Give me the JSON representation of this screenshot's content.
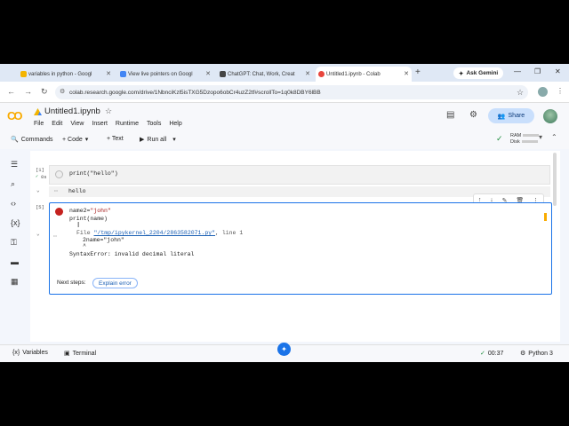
{
  "browser": {
    "tabs": [
      {
        "label": "variables in python - Googl",
        "fav_color": "#f4b400"
      },
      {
        "label": "View live pointers on Googl",
        "fav_color": "#4285f4"
      },
      {
        "label": "ChatGPT: Chat, Work, Creat",
        "fav_color": "#444444"
      },
      {
        "label": "Untitled1.ipynb - Colab",
        "fav_color": "#e8453c"
      }
    ],
    "new_tab": "+",
    "ask_gemini": "Ask Gemini",
    "url": "colab.research.google.com/drive/1NbnciKzl5isTXG5Dzopo6obCr4uzZ2tf#scrollTo=1q0k8DBY6lBB"
  },
  "colab": {
    "logo": "CO",
    "notebook_title": "Untitled1.ipynb",
    "menu": [
      "File",
      "Edit",
      "View",
      "Insert",
      "Runtime",
      "Tools",
      "Help"
    ],
    "share_label": "Share",
    "toolbar": {
      "commands": "Commands",
      "code": "+ Code",
      "text": "+ Text",
      "run_all": "Run all"
    },
    "ram_label": "RAM",
    "disk_label": "Disk"
  },
  "cells": {
    "cell1": {
      "exec_count": "[1]",
      "exec_time": "0s",
      "code": "print(\"hello\")",
      "output": "hello"
    },
    "cell2": {
      "exec_count": "[5]",
      "line1_var": "name2",
      "line1_eq": "=",
      "line1_str": "\"john\"",
      "line2": "print(name)",
      "err_file_prefix": "File ",
      "err_file_link": "\"/tmp/ipykernel_2204/2863582071.py\"",
      "err_file_suffix": ", line 1",
      "err_code": "2name=\"john\"",
      "err_caret": "^",
      "err_message": "SyntaxError: invalid decimal literal",
      "next_steps": "Next steps:",
      "explain_error": "Explain error"
    }
  },
  "statusbar": {
    "variables": "Variables",
    "terminal": "Terminal",
    "time": "00:37",
    "python": "Python 3"
  }
}
